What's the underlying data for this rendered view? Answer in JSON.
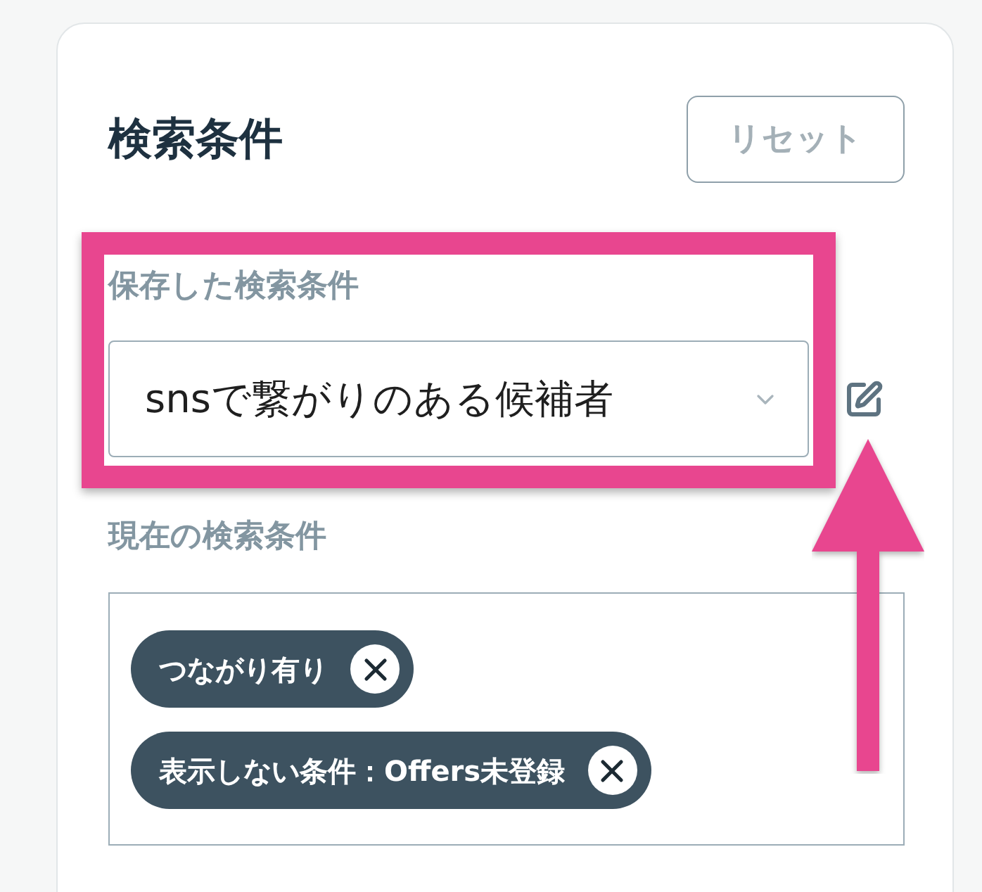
{
  "panel": {
    "title": "検索条件",
    "reset_button": "リセット"
  },
  "saved_search": {
    "label": "保存した検索条件",
    "value": "snsで繋がりのある候補者"
  },
  "current_conditions": {
    "label": "現在の検索条件",
    "chips": [
      {
        "label": "つながり有り"
      },
      {
        "label": "表示しない条件：Offers未登録"
      }
    ]
  }
}
